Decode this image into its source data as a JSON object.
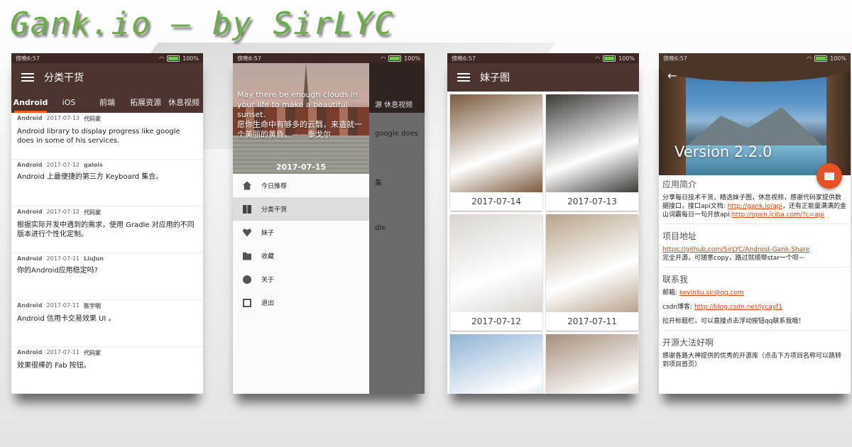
{
  "banner": {
    "title": "Gank.io — by SirLYC"
  },
  "status": {
    "time": "傍晚6:57",
    "battery": "100%"
  },
  "screen1": {
    "toolbar_title": "分类干货",
    "tabs": [
      "Android",
      "iOS",
      "前端",
      "拓展资源",
      "休息视频"
    ],
    "items": [
      {
        "cat": "Android",
        "date": "2017-07-13",
        "author": "代码家",
        "desc": "Android library to display progress like google does in some of his services."
      },
      {
        "cat": "Android",
        "date": "2017-07-12",
        "author": "galois",
        "desc": "Android 上最便捷的第三方 Keyboard 集合。"
      },
      {
        "cat": "Android",
        "date": "2017-07-12",
        "author": "代码家",
        "desc": "根据实际开发中遇到的需求，使用 Gradle 对应用的不同版本进行个性化定制。"
      },
      {
        "cat": "Android",
        "date": "2017-07-11",
        "author": "LiuJun",
        "desc": "你的Android应用稳定吗?"
      },
      {
        "cat": "Android",
        "date": "2017-07-11",
        "author": "陈宇明",
        "desc": "Android 信用卡交易效果 UI 。"
      },
      {
        "cat": "Android",
        "date": "2017-07-11",
        "author": "代码家",
        "desc": "效果很棒的 Fab 按钮。"
      }
    ]
  },
  "screen2": {
    "quote_en": "May there be enough clouds in your life to make a beautiful sunset.",
    "quote_cn": "愿你生命中有够多的云翳，来造就一个美丽的黄昏。——泰戈尔",
    "date": "2017-07-15",
    "ghost_tabs": "源    休息视频",
    "ghost_line1": "google does",
    "ghost_line2": "集",
    "ghost_line3": "dle",
    "nav": [
      {
        "label": "今日推荐",
        "icon": "home-icon"
      },
      {
        "label": "分类干货",
        "icon": "dashboard-icon"
      },
      {
        "label": "妹子",
        "icon": "heart-icon"
      },
      {
        "label": "收藏",
        "icon": "star-folder-icon"
      },
      {
        "label": "关于",
        "icon": "info-icon"
      },
      {
        "label": "退出",
        "icon": "exit-icon"
      }
    ]
  },
  "screen3": {
    "toolbar_title": "妹子图",
    "cards": [
      {
        "date": "2017-07-14",
        "color": "#7a5a3c"
      },
      {
        "date": "2017-07-13",
        "color": "#3e3a36"
      },
      {
        "date": "2017-07-12",
        "color": "#d9d4cf"
      },
      {
        "date": "2017-07-11",
        "color": "#b7a38a"
      },
      {
        "date": "",
        "color": "#8fb3d4"
      },
      {
        "date": "",
        "color": "#a58f7c"
      }
    ]
  },
  "screen4": {
    "version": "Version 2.2.0",
    "sections": {
      "intro_title": "应用简介",
      "intro_text": "分享每日技术干货，精选妹子图，休息视频，感谢代码家提供数据接口，接口api文档: ",
      "intro_link1": "http://gank.io/api",
      "intro_text2": "，还有正能量满满的金山词霸每日一句开放api:",
      "intro_link2": "http://open.iciba.com/?c=api",
      "project_title": "项目地址",
      "project_link": "https://github.com/SirLYC/Android-Gank-Share",
      "project_text": "完全开源，可随意copy，路过就顺带star一个呗~",
      "contact_title": "联系我",
      "email_label": "邮箱: ",
      "email": "kevinliu.sir@qq.com",
      "csdn_label": "csdn博客: ",
      "csdn": "http://blog.csdn.net/lycayf1",
      "contact_text": "拉开标题栏，可以直接点击浮动按钮qq联系我哦！",
      "oss_title": "开源大法好啊",
      "oss_text": "感谢各路大神提供的优秀的开源库（点击下方项目名称可以跳转到项目首页）"
    }
  }
}
